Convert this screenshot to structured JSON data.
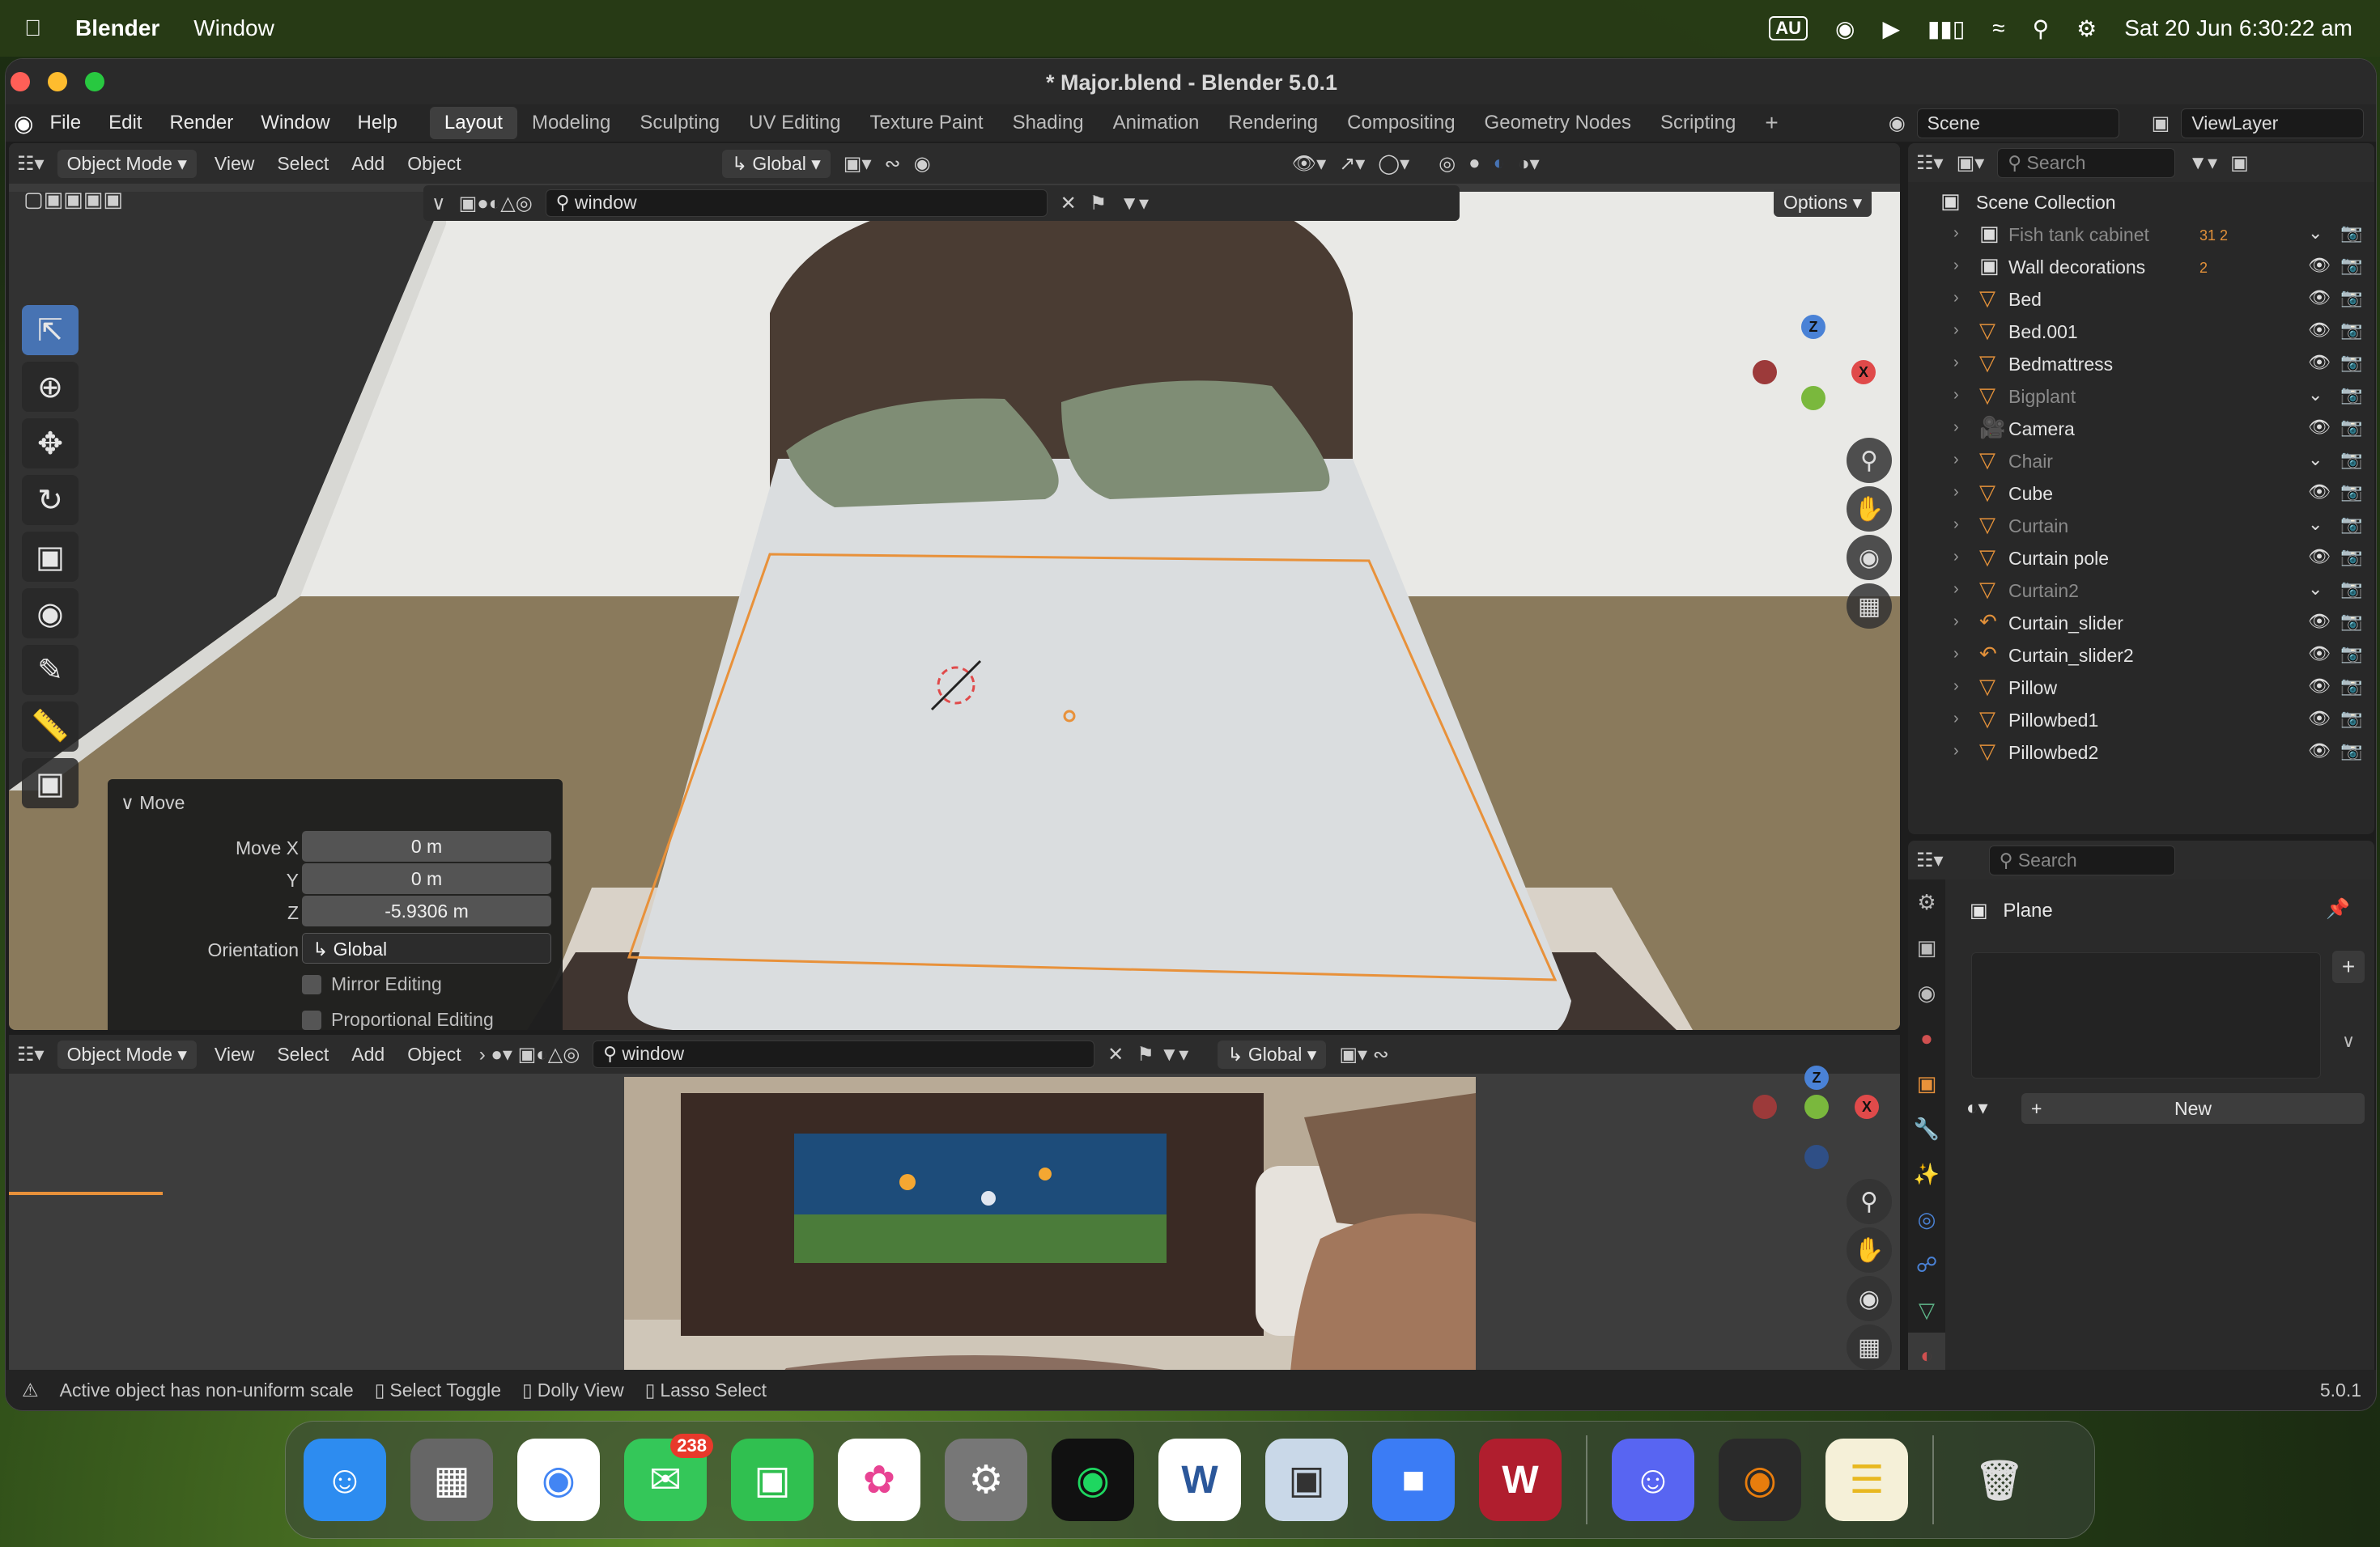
{
  "menubar": {
    "app": "Blender",
    "menu": "Window",
    "status_au": "AU",
    "clock": "Sat 20 Jun  6:30:22 am"
  },
  "window": {
    "title": "* Major.blend - Blender 5.0.1"
  },
  "topbar": {
    "menus": [
      "File",
      "Edit",
      "Render",
      "Window",
      "Help"
    ],
    "workspaces": [
      "Layout",
      "Modeling",
      "Sculpting",
      "UV Editing",
      "Texture Paint",
      "Shading",
      "Animation",
      "Rendering",
      "Compositing",
      "Geometry Nodes",
      "Scripting"
    ],
    "active_workspace": "Layout",
    "scene": "Scene",
    "view_layer": "ViewLayer"
  },
  "viewport1": {
    "mode": "Object Mode",
    "menus": [
      "View",
      "Select",
      "Add",
      "Object"
    ],
    "orientation": "Global",
    "search_value": "window",
    "options_label": "Options"
  },
  "move_panel": {
    "title": "Move",
    "move_x_label": "Move X",
    "move_x": "0 m",
    "y_label": "Y",
    "y": "0 m",
    "z_label": "Z",
    "z": "-5.9306 m",
    "orientation_label": "Orientation",
    "orientation": "Global",
    "mirror_label": "Mirror Editing",
    "proportional_label": "Proportional Editing"
  },
  "viewport2": {
    "mode": "Object Mode",
    "menus": [
      "View",
      "Select",
      "Add",
      "Object"
    ],
    "search_value": "window",
    "orientation": "Global"
  },
  "gizmo_axes": {
    "z": "Z",
    "x": "X"
  },
  "outliner": {
    "search_placeholder": "Search",
    "collection": "Scene Collection",
    "items": [
      {
        "name": "Fish tank cabinet",
        "dim": true,
        "extra": "31 2"
      },
      {
        "name": "Wall decorations",
        "dim": false,
        "extra": "2"
      },
      {
        "name": "Bed",
        "dim": false
      },
      {
        "name": "Bed.001",
        "dim": false
      },
      {
        "name": "Bedmattress",
        "dim": false
      },
      {
        "name": "Bigplant",
        "dim": true
      },
      {
        "name": "Camera",
        "dim": false
      },
      {
        "name": "Chair",
        "dim": true
      },
      {
        "name": "Cube",
        "dim": false
      },
      {
        "name": "Curtain",
        "dim": true
      },
      {
        "name": "Curtain pole",
        "dim": false
      },
      {
        "name": "Curtain2",
        "dim": true
      },
      {
        "name": "Curtain_slider",
        "dim": false
      },
      {
        "name": "Curtain_slider2",
        "dim": false
      },
      {
        "name": "Pillow",
        "dim": false
      },
      {
        "name": "Pillowbed1",
        "dim": false
      },
      {
        "name": "Pillowbed2",
        "dim": false
      }
    ]
  },
  "properties": {
    "search_placeholder": "Search",
    "object_name": "Plane",
    "new_label": "New"
  },
  "statusbar": {
    "warning": "Active object has non-uniform scale",
    "hint1": "Select Toggle",
    "hint2": "Dolly View",
    "hint3": "Lasso Select",
    "version": "5.0.1"
  },
  "dock": {
    "messages_badge": "238",
    "word_letter": "W",
    "wolfram_letter": "W"
  },
  "colors": {
    "accent_blue": "#4773b3",
    "selection_orange": "#e8913a",
    "axis_x": "#e04a4a",
    "axis_y": "#7ab83d",
    "axis_z": "#4a82d6"
  }
}
